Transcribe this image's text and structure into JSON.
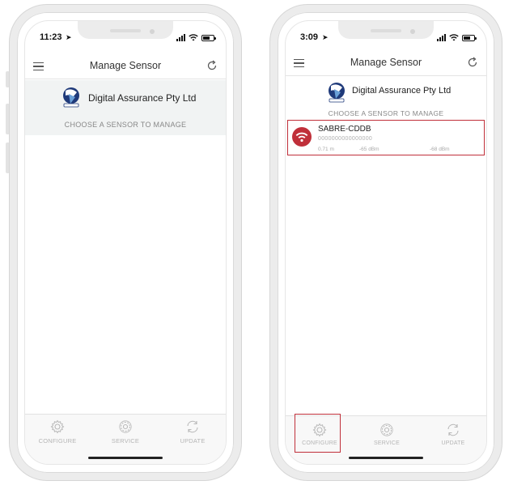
{
  "left_phone": {
    "status": {
      "time": "11:23"
    },
    "navbar": {
      "title": "Manage Sensor"
    },
    "company": {
      "name": "Digital Assurance Pty Ltd",
      "prompt": "CHOOSE A SENSOR TO MANAGE"
    },
    "tabs": [
      {
        "label": "CONFIGURE",
        "icon": "gear-icon"
      },
      {
        "label": "SERVICE",
        "icon": "cog-icon"
      },
      {
        "label": "UPDATE",
        "icon": "sync-icon"
      }
    ]
  },
  "right_phone": {
    "status": {
      "time": "3:09"
    },
    "navbar": {
      "title": "Manage Sensor"
    },
    "company": {
      "name": "Digital Assurance Pty Ltd",
      "prompt": "CHOOSE A SENSOR TO MANAGE"
    },
    "sensor": {
      "name": "SABRE-CDDB",
      "id": "0000000000000000",
      "distance": "0.71 m",
      "rssi_1": "-65 dBm",
      "rssi_2": "-68 dBm",
      "icon": "wifi-icon"
    },
    "tabs": [
      {
        "label": "CONFIGURE",
        "icon": "gear-icon"
      },
      {
        "label": "SERVICE",
        "icon": "cog-icon"
      },
      {
        "label": "UPDATE",
        "icon": "sync-icon"
      }
    ]
  },
  "colors": {
    "accent_red": "#c0303a",
    "header_bg": "#f1f3f3",
    "tab_label": "#b5b5b5"
  }
}
